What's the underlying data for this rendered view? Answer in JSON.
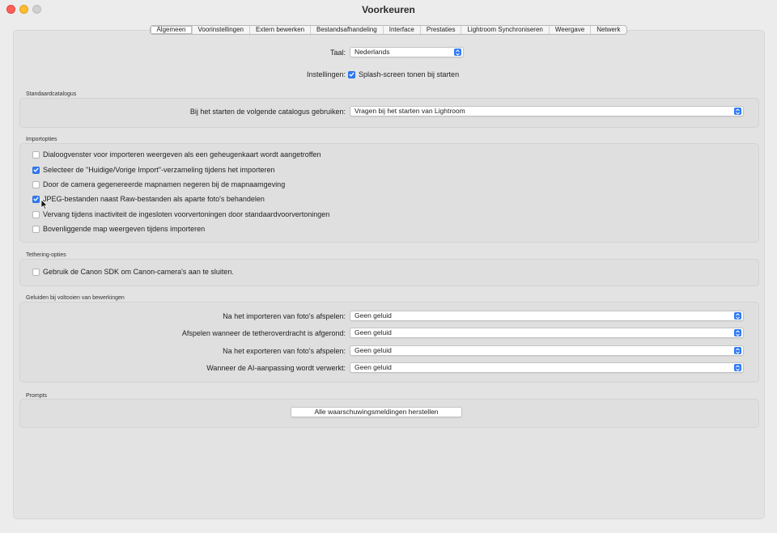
{
  "window": {
    "title": "Voorkeuren"
  },
  "tabs": [
    {
      "label": "Algemeen",
      "active": true
    },
    {
      "label": "Voorinstellingen"
    },
    {
      "label": "Extern bewerken"
    },
    {
      "label": "Bestandsafhandeling"
    },
    {
      "label": "Interface"
    },
    {
      "label": "Prestaties"
    },
    {
      "label": "Lightroom Synchroniseren"
    },
    {
      "label": "Weergave"
    },
    {
      "label": "Netwerk"
    }
  ],
  "general": {
    "language_label": "Taal:",
    "language_value": "Nederlands",
    "settings_label": "Instellingen:",
    "splash_label": "Splash-screen tonen bij starten",
    "splash_checked": true
  },
  "catalog": {
    "section_title": "Standaardcatalogus",
    "label": "Bij het starten de volgende catalogus gebruiken:",
    "value": "Vragen bij het starten van Lightroom"
  },
  "import": {
    "section_title": "Importopties",
    "options": [
      {
        "label": "Dialoogvenster voor importeren weergeven als een geheugenkaart wordt aangetroffen",
        "checked": false
      },
      {
        "label": "Selecteer de \"Huidige/Vorige Import\"-verzameling tijdens het importeren",
        "checked": true
      },
      {
        "label": "Door de camera gegenereerde mapnamen negeren bij de mapnaamgeving",
        "checked": false
      },
      {
        "label": "JPEG-bestanden naast Raw-bestanden als aparte foto's behandelen",
        "checked": true
      },
      {
        "label": "Vervang tijdens inactiviteit de ingesloten voorvertoningen door standaardvoorvertoningen",
        "checked": false
      },
      {
        "label": "Bovenliggende map weergeven tijdens importeren",
        "checked": false
      }
    ]
  },
  "tethering": {
    "section_title": "Tethering-opties",
    "option_label": "Gebruik de Canon SDK om Canon-camera's aan te sluiten.",
    "checked": false
  },
  "sounds": {
    "section_title": "Geluiden bij voltooien van bewerkingen",
    "rows": [
      {
        "label": "Na het importeren van foto's afspelen:",
        "value": "Geen geluid"
      },
      {
        "label": "Afspelen wanneer de tetheroverdracht is afgerond:",
        "value": "Geen geluid"
      },
      {
        "label": "Na het exporteren van foto's afspelen:",
        "value": "Geen geluid"
      },
      {
        "label": "Wanneer de AI-aanpassing wordt verwerkt:",
        "value": "Geen geluid"
      }
    ]
  },
  "prompts": {
    "section_title": "Prompts",
    "reset_button": "Alle waarschuwingsmeldingen herstellen"
  },
  "colors": {
    "accent": "#2f7bf5",
    "background": "#ececec",
    "panel": "#e3e3e3"
  }
}
